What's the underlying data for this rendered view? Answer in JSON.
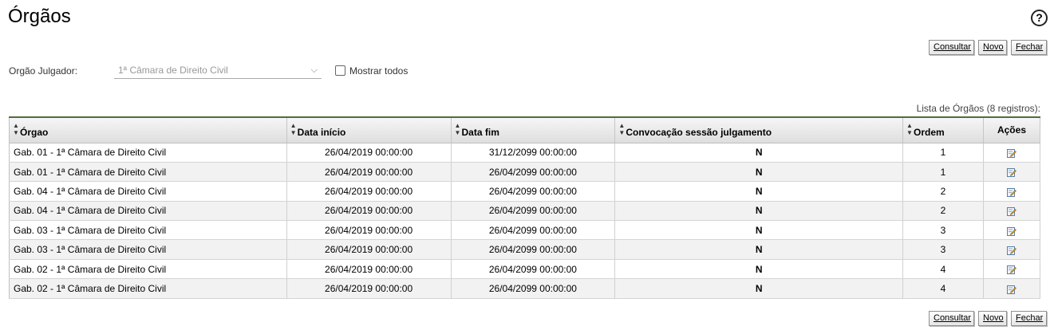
{
  "page": {
    "title": "Órgãos",
    "help_glyph": "?"
  },
  "buttons": {
    "consultar": "Consultar",
    "novo": "Novo",
    "fechar": "Fechar"
  },
  "filter": {
    "label": "Orgão Julgador:",
    "selected": "1ª Câmara de Direito Civil",
    "mostrar_todos": "Mostrar todos"
  },
  "list_caption": "Lista de Órgãos (8 registros):",
  "table": {
    "columns": [
      "Órgao",
      "Data início",
      "Data fim",
      "Convocação sessão julgamento",
      "Ordem",
      "Ações"
    ],
    "rows": [
      [
        "Gab. 01 - 1ª Câmara de Direito Civil",
        "26/04/2019 00:00:00",
        "31/12/2099 00:00:00",
        "N",
        "1"
      ],
      [
        "Gab. 01 - 1ª Câmara de Direito Civil",
        "26/04/2019 00:00:00",
        "26/04/2099 00:00:00",
        "N",
        "1"
      ],
      [
        "Gab. 04 - 1ª Câmara de Direito Civil",
        "26/04/2019 00:00:00",
        "26/04/2099 00:00:00",
        "N",
        "2"
      ],
      [
        "Gab. 04 - 1ª Câmara de Direito Civil",
        "26/04/2019 00:00:00",
        "26/04/2099 00:00:00",
        "N",
        "2"
      ],
      [
        "Gab. 03 - 1ª Câmara de Direito Civil",
        "26/04/2019 00:00:00",
        "26/04/2099 00:00:00",
        "N",
        "3"
      ],
      [
        "Gab. 03 - 1ª Câmara de Direito Civil",
        "26/04/2019 00:00:00",
        "26/04/2099 00:00:00",
        "N",
        "3"
      ],
      [
        "Gab. 02 - 1ª Câmara de Direito Civil",
        "26/04/2019 00:00:00",
        "26/04/2099 00:00:00",
        "N",
        "4"
      ],
      [
        "Gab. 02 - 1ª Câmara de Direito Civil",
        "26/04/2019 00:00:00",
        "26/04/2099 00:00:00",
        "N",
        "4"
      ]
    ]
  },
  "icons": {
    "help": "help-circle-icon",
    "sort": "sort-arrows-icon",
    "edit": "edit-pencil-icon",
    "dropdown": "chevron-down-icon"
  },
  "colors": {
    "header_accent": "#4f6f3a",
    "row_alt": "#f2f2f2"
  }
}
